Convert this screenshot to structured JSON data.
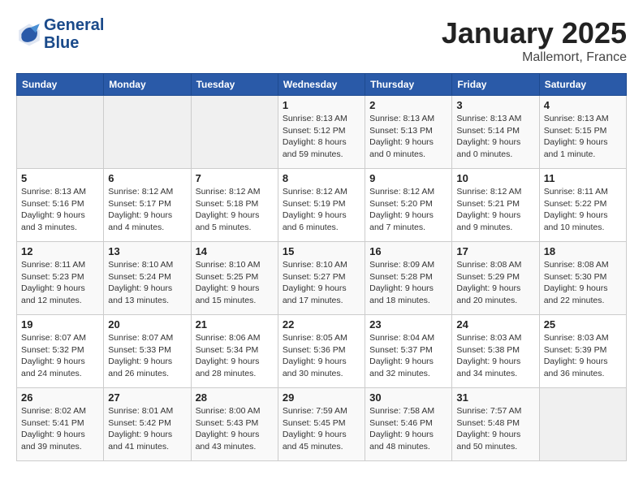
{
  "header": {
    "logo_line1": "General",
    "logo_line2": "Blue",
    "month": "January 2025",
    "location": "Mallemort, France"
  },
  "days_of_week": [
    "Sunday",
    "Monday",
    "Tuesday",
    "Wednesday",
    "Thursday",
    "Friday",
    "Saturday"
  ],
  "weeks": [
    [
      {
        "day": "",
        "info": ""
      },
      {
        "day": "",
        "info": ""
      },
      {
        "day": "",
        "info": ""
      },
      {
        "day": "1",
        "info": "Sunrise: 8:13 AM\nSunset: 5:12 PM\nDaylight: 8 hours\nand 59 minutes."
      },
      {
        "day": "2",
        "info": "Sunrise: 8:13 AM\nSunset: 5:13 PM\nDaylight: 9 hours\nand 0 minutes."
      },
      {
        "day": "3",
        "info": "Sunrise: 8:13 AM\nSunset: 5:14 PM\nDaylight: 9 hours\nand 0 minutes."
      },
      {
        "day": "4",
        "info": "Sunrise: 8:13 AM\nSunset: 5:15 PM\nDaylight: 9 hours\nand 1 minute."
      }
    ],
    [
      {
        "day": "5",
        "info": "Sunrise: 8:13 AM\nSunset: 5:16 PM\nDaylight: 9 hours\nand 3 minutes."
      },
      {
        "day": "6",
        "info": "Sunrise: 8:12 AM\nSunset: 5:17 PM\nDaylight: 9 hours\nand 4 minutes."
      },
      {
        "day": "7",
        "info": "Sunrise: 8:12 AM\nSunset: 5:18 PM\nDaylight: 9 hours\nand 5 minutes."
      },
      {
        "day": "8",
        "info": "Sunrise: 8:12 AM\nSunset: 5:19 PM\nDaylight: 9 hours\nand 6 minutes."
      },
      {
        "day": "9",
        "info": "Sunrise: 8:12 AM\nSunset: 5:20 PM\nDaylight: 9 hours\nand 7 minutes."
      },
      {
        "day": "10",
        "info": "Sunrise: 8:12 AM\nSunset: 5:21 PM\nDaylight: 9 hours\nand 9 minutes."
      },
      {
        "day": "11",
        "info": "Sunrise: 8:11 AM\nSunset: 5:22 PM\nDaylight: 9 hours\nand 10 minutes."
      }
    ],
    [
      {
        "day": "12",
        "info": "Sunrise: 8:11 AM\nSunset: 5:23 PM\nDaylight: 9 hours\nand 12 minutes."
      },
      {
        "day": "13",
        "info": "Sunrise: 8:10 AM\nSunset: 5:24 PM\nDaylight: 9 hours\nand 13 minutes."
      },
      {
        "day": "14",
        "info": "Sunrise: 8:10 AM\nSunset: 5:25 PM\nDaylight: 9 hours\nand 15 minutes."
      },
      {
        "day": "15",
        "info": "Sunrise: 8:10 AM\nSunset: 5:27 PM\nDaylight: 9 hours\nand 17 minutes."
      },
      {
        "day": "16",
        "info": "Sunrise: 8:09 AM\nSunset: 5:28 PM\nDaylight: 9 hours\nand 18 minutes."
      },
      {
        "day": "17",
        "info": "Sunrise: 8:08 AM\nSunset: 5:29 PM\nDaylight: 9 hours\nand 20 minutes."
      },
      {
        "day": "18",
        "info": "Sunrise: 8:08 AM\nSunset: 5:30 PM\nDaylight: 9 hours\nand 22 minutes."
      }
    ],
    [
      {
        "day": "19",
        "info": "Sunrise: 8:07 AM\nSunset: 5:32 PM\nDaylight: 9 hours\nand 24 minutes."
      },
      {
        "day": "20",
        "info": "Sunrise: 8:07 AM\nSunset: 5:33 PM\nDaylight: 9 hours\nand 26 minutes."
      },
      {
        "day": "21",
        "info": "Sunrise: 8:06 AM\nSunset: 5:34 PM\nDaylight: 9 hours\nand 28 minutes."
      },
      {
        "day": "22",
        "info": "Sunrise: 8:05 AM\nSunset: 5:36 PM\nDaylight: 9 hours\nand 30 minutes."
      },
      {
        "day": "23",
        "info": "Sunrise: 8:04 AM\nSunset: 5:37 PM\nDaylight: 9 hours\nand 32 minutes."
      },
      {
        "day": "24",
        "info": "Sunrise: 8:03 AM\nSunset: 5:38 PM\nDaylight: 9 hours\nand 34 minutes."
      },
      {
        "day": "25",
        "info": "Sunrise: 8:03 AM\nSunset: 5:39 PM\nDaylight: 9 hours\nand 36 minutes."
      }
    ],
    [
      {
        "day": "26",
        "info": "Sunrise: 8:02 AM\nSunset: 5:41 PM\nDaylight: 9 hours\nand 39 minutes."
      },
      {
        "day": "27",
        "info": "Sunrise: 8:01 AM\nSunset: 5:42 PM\nDaylight: 9 hours\nand 41 minutes."
      },
      {
        "day": "28",
        "info": "Sunrise: 8:00 AM\nSunset: 5:43 PM\nDaylight: 9 hours\nand 43 minutes."
      },
      {
        "day": "29",
        "info": "Sunrise: 7:59 AM\nSunset: 5:45 PM\nDaylight: 9 hours\nand 45 minutes."
      },
      {
        "day": "30",
        "info": "Sunrise: 7:58 AM\nSunset: 5:46 PM\nDaylight: 9 hours\nand 48 minutes."
      },
      {
        "day": "31",
        "info": "Sunrise: 7:57 AM\nSunset: 5:48 PM\nDaylight: 9 hours\nand 50 minutes."
      },
      {
        "day": "",
        "info": ""
      }
    ]
  ]
}
